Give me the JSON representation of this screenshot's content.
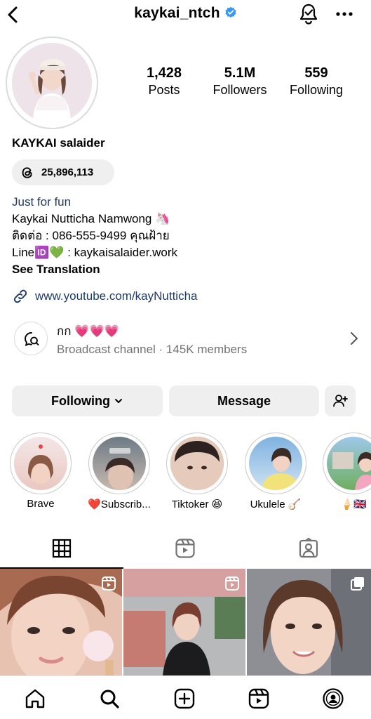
{
  "header": {
    "username": "kaykai_ntch",
    "icons": [
      "back-icon",
      "verified-badge-icon",
      "notification-bell-icon",
      "more-icon"
    ]
  },
  "profile": {
    "stats": [
      {
        "value": "1,428",
        "label": "Posts"
      },
      {
        "value": "5.1M",
        "label": "Followers"
      },
      {
        "value": "559",
        "label": "Following"
      }
    ],
    "display_name": "KAYKAI salaider",
    "threads_count": "25,896,113",
    "bio": {
      "category": "Just for fun",
      "line1": "Kaykai Nutticha Namwong 🦄",
      "line2": "ติดต่อ : 086-555-9499 คุณฝ้าย",
      "line3": "Line🆔💚 : kaykaisalaider.work",
      "see_translation": "See Translation"
    },
    "link": "www.youtube.com/kayNutticha"
  },
  "broadcast": {
    "title": "กก 💗💗💗",
    "subtitle": "Broadcast channel · 145K members"
  },
  "actions": {
    "following_label": "Following",
    "message_label": "Message"
  },
  "highlights": [
    {
      "label": "Brave",
      "colors": [
        "#f4e6e8",
        "#e9c8c0"
      ]
    },
    {
      "label": "❤️Subscrib...",
      "colors": [
        "#6d7a86",
        "#c7b8ae"
      ]
    },
    {
      "label": "Tiktoker 😆",
      "colors": [
        "#3b2c2a",
        "#d9b9aa"
      ]
    },
    {
      "label": "Ukulele 🪕",
      "colors": [
        "#7fb2e0",
        "#f2e27a"
      ]
    },
    {
      "label": "🍦🇬🇧",
      "colors": [
        "#6fae5e",
        "#f4a6c0"
      ]
    }
  ],
  "tabs": [
    "grid-icon",
    "reels-icon",
    "tagged-icon"
  ],
  "posts": [
    {
      "type": "reel",
      "colors": [
        "#d9a38f",
        "#f1d2c6"
      ]
    },
    {
      "type": "reel",
      "colors": [
        "#9c4a3e",
        "#e7c0ae"
      ]
    },
    {
      "type": "carousel",
      "colors": [
        "#5b4a44",
        "#f0d1c2"
      ]
    }
  ],
  "bottom_nav": [
    "home-icon",
    "search-icon",
    "create-icon",
    "reels-nav-icon",
    "profile-icon"
  ]
}
